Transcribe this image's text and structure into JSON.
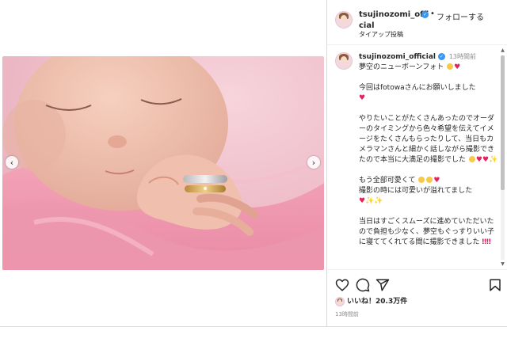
{
  "post": {
    "author": "tsujinozomi_official",
    "follow_dot": "•",
    "follow_label": "フォローする",
    "subtitle": "タイアップ投稿",
    "caption_time": "13時間前",
    "caption_title": "夢空のニューボーンフォト",
    "paragraph1": "今回はfotowaさんにお願いしました",
    "paragraph2": "やりたいことがたくさんあったのでオーダーのタイミングから色々希望を伝えてイメージをたくさんもらったりして、当日もカメラマンさんと細かく話しながら撮影できたので本当に大満足の撮影でした",
    "paragraph3a": "もう全部可愛くて",
    "paragraph3b": "撮影の時には可愛いが溢れてました",
    "paragraph4": "当日はすごくスムーズに進めていただいたので負担も少なく、夢空もぐっすりいい子に寝ててくれてる間に撮影できました",
    "likes_label": "いいね！20.3万件",
    "timestamp": "13時間前"
  },
  "icons": {
    "prev": "chevron-left-icon",
    "next": "chevron-right-icon",
    "like": "heart-icon",
    "comment": "comment-icon",
    "share": "share-icon",
    "save": "bookmark-icon",
    "verified": "verified-badge-icon"
  },
  "glyphs": {
    "prev": "‹",
    "next": "›",
    "verified": "✓",
    "scroll_up": "▲",
    "scroll_down": "▼"
  },
  "colors": {
    "accent": "#3897f0",
    "heart": "#e0245e",
    "blanket": "#f4a8bd"
  }
}
